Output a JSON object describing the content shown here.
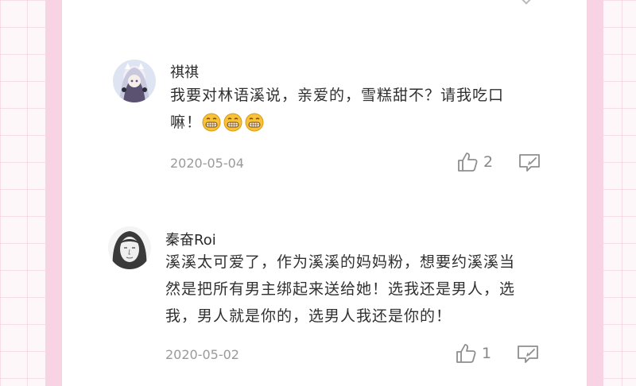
{
  "comments": [
    {
      "username": "祺祺",
      "content_lines": [
        "我要对林语溪说，亲爱的，雪糕甜不？请我吃口",
        "嘛！"
      ],
      "emojis": [
        "grin-emoji",
        "grin-emoji",
        "grin-emoji"
      ],
      "date": "2020-05-04",
      "likes": "2",
      "avatar_icon": "anime-girl-avatar"
    },
    {
      "username": "秦奋Roi",
      "content_lines": [
        "溪溪太可爱了，作为溪溪的妈妈粉，想要约溪溪当",
        "然是把所有男主绑起来送给她！选我还是男人，选",
        "我，男人就是你的，选男人我还是你的！"
      ],
      "date": "2020-05-02",
      "likes": "1",
      "avatar_icon": "sketch-portrait-avatar"
    }
  ],
  "icons": {
    "like": "thumbs-up-icon",
    "reply": "comment-icon"
  },
  "colors": {
    "background_grid": "#fdf7fa",
    "pink_band": "#f7d3e3",
    "emoji_face": "#f7c23a"
  }
}
